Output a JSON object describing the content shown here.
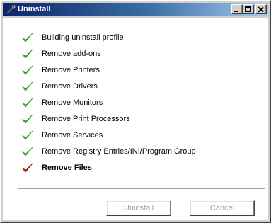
{
  "window": {
    "title": "Uninstall",
    "icon": "uninstall-app-icon",
    "controls": [
      "minimize-icon",
      "maximize-icon",
      "close-icon"
    ]
  },
  "steps": [
    {
      "label": "Building uninstall profile",
      "status": "done"
    },
    {
      "label": "Remove add-ons",
      "status": "done"
    },
    {
      "label": "Remove Printers",
      "status": "done"
    },
    {
      "label": "Remove Drivers",
      "status": "done"
    },
    {
      "label": "Remove Monitors",
      "status": "done"
    },
    {
      "label": "Remove Print Processors",
      "status": "done"
    },
    {
      "label": "Remove Services",
      "status": "done"
    },
    {
      "label": "Remove Registry Entries/INI/Program Group",
      "status": "done"
    },
    {
      "label": "Remove Files",
      "status": "current"
    }
  ],
  "buttons": {
    "uninstall_label": "Uninstall",
    "cancel_label": "Cancel",
    "enabled": false
  },
  "colors": {
    "done_check": "#22c32e",
    "current_check": "#e01010",
    "title_gradient_start": "#0a246a",
    "title_gradient_end": "#a6caf0"
  }
}
